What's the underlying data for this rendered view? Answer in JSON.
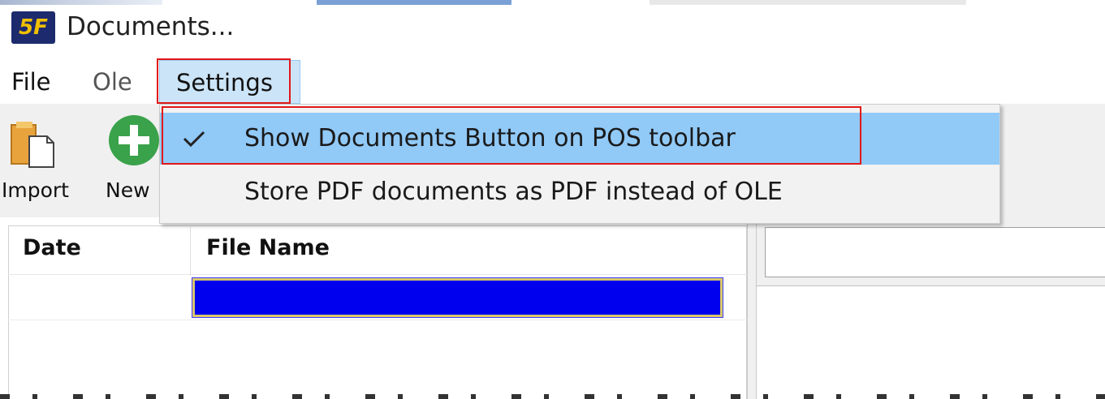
{
  "window": {
    "logo_text": "5F",
    "title": "Documents..."
  },
  "menubar": {
    "file": "File",
    "ole": "Ole",
    "settings": "Settings"
  },
  "toolbar": {
    "import_label": "Import",
    "new_label": "New"
  },
  "table": {
    "columns": [
      "Date",
      "File Name"
    ],
    "rows": [
      {
        "date": "",
        "file_name": "",
        "selected": true
      }
    ]
  },
  "settings_menu": {
    "items": [
      {
        "label": "Show Documents Button on POS toolbar",
        "checked": true,
        "highlighted": true
      },
      {
        "label": "Store PDF documents as PDF instead of OLE",
        "checked": false,
        "highlighted": false
      }
    ]
  },
  "colors": {
    "highlight_outline": "#e01818",
    "menu_hover": "#91c9f7",
    "selected_cell": "#0000ee",
    "new_icon": "#3aa24a"
  }
}
